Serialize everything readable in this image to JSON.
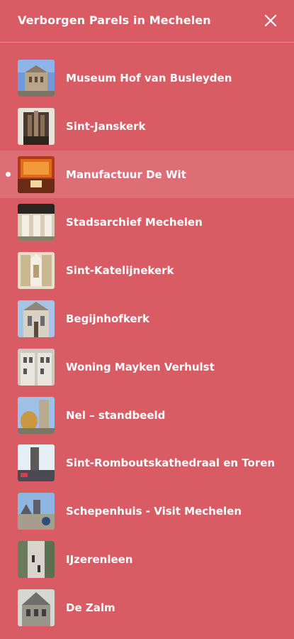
{
  "header": {
    "title": "Verborgen Parels in Mechelen",
    "close_icon": "close-icon"
  },
  "colors": {
    "background": "#d95b63",
    "text": "#ffffff",
    "active_row": "rgba(255,255,255,0.12)"
  },
  "items": [
    {
      "label": "Museum Hof van Busleyden",
      "active": false
    },
    {
      "label": "Sint-Janskerk",
      "active": false
    },
    {
      "label": "Manufactuur De Wit",
      "active": true
    },
    {
      "label": "Stadsarchief Mechelen",
      "active": false
    },
    {
      "label": "Sint-Katelijnekerk",
      "active": false
    },
    {
      "label": "Begijnhofkerk",
      "active": false
    },
    {
      "label": "Woning Mayken Verhulst",
      "active": false
    },
    {
      "label": "Nel – standbeeld",
      "active": false
    },
    {
      "label": "Sint-Romboutskathedraal en Toren",
      "active": false
    },
    {
      "label": "Schepenhuis - Visit Mechelen",
      "active": false
    },
    {
      "label": "IJzerenleen",
      "active": false
    },
    {
      "label": "De Zalm",
      "active": false
    }
  ]
}
